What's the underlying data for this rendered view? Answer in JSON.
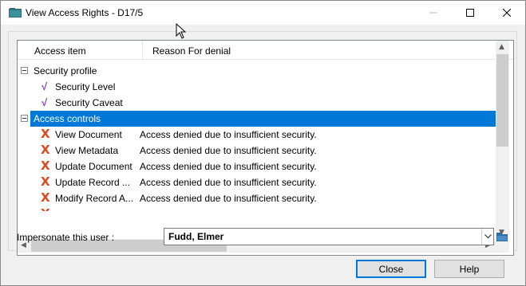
{
  "window": {
    "title": "View Access Rights - D17/5",
    "controls": {
      "minimize": "minimize-icon",
      "maximize": "maximize-icon",
      "close": "close-icon"
    }
  },
  "tree": {
    "columns": [
      "Access item",
      "Reason For denial"
    ],
    "rows": [
      {
        "type": "group",
        "label": "Security profile",
        "expanded": true,
        "selected": false
      },
      {
        "type": "item",
        "icon": "check-icon",
        "label": "Security Level",
        "reason": ""
      },
      {
        "type": "item",
        "icon": "check-icon",
        "label": "Security Caveat",
        "reason": ""
      },
      {
        "type": "group",
        "label": "Access controls",
        "expanded": true,
        "selected": true
      },
      {
        "type": "item",
        "icon": "cross-icon",
        "label": "View Document",
        "reason": "Access denied due to insufficient security."
      },
      {
        "type": "item",
        "icon": "cross-icon",
        "label": "View Metadata",
        "reason": "Access denied due to insufficient security."
      },
      {
        "type": "item",
        "icon": "cross-icon",
        "label": "Update Document",
        "reason": "Access denied due to insufficient security."
      },
      {
        "type": "item",
        "icon": "cross-icon",
        "label": "Update Record ...",
        "reason": "Access denied due to insufficient security."
      },
      {
        "type": "item",
        "icon": "cross-icon",
        "label": "Modify Record A...",
        "reason": "Access denied due to insufficient security."
      }
    ]
  },
  "impersonate": {
    "label": "Impersonate this user :",
    "value": "Fudd, Elmer"
  },
  "buttons": {
    "close": "Close",
    "help": "Help"
  },
  "colors": {
    "selection": "#0078d7",
    "check": "#7a3ccf",
    "cross": "#e0471f"
  }
}
